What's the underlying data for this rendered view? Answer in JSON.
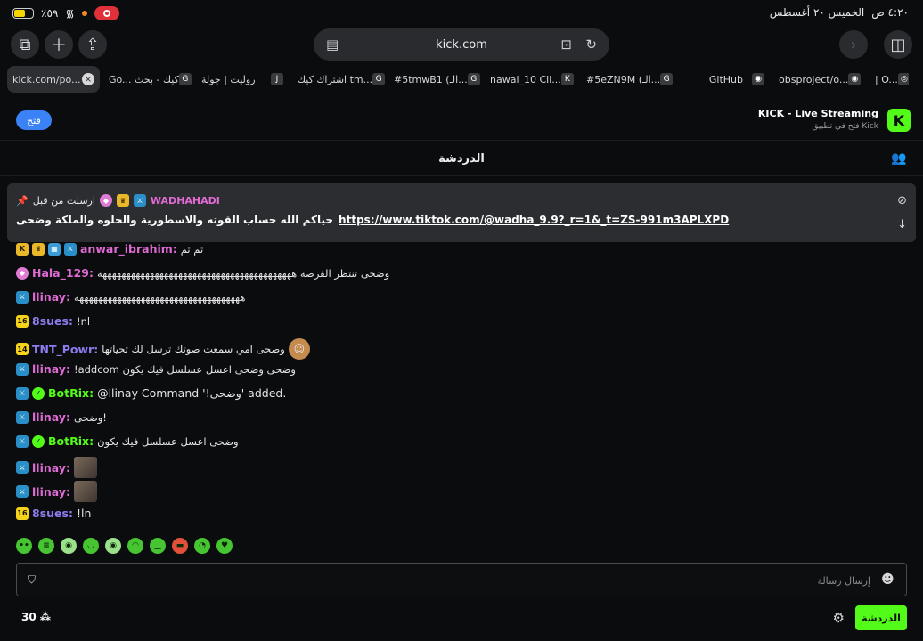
{
  "status_bar": {
    "battery": "٪٥٩",
    "time": "٤:٢٠ ص",
    "date": "الخميس ٢٠ أغسطس"
  },
  "browser": {
    "address": "kick.com",
    "tabs": [
      {
        "label": "kick.com/po...",
        "fav": "K",
        "active": true
      },
      {
        "label": "Go... كيك - بحث",
        "fav": "G"
      },
      {
        "label": "روليت | جولة",
        "fav": "J"
      },
      {
        "label": "اشتراك كيك tm...",
        "fav": "G"
      },
      {
        "label": "#5tmwB1 (الـ...",
        "fav": "G"
      },
      {
        "label": "nawal_10 Cli...",
        "fav": "K"
      },
      {
        "label": "#5eZN9M (الـ...",
        "fav": "G"
      },
      {
        "label": "GitHub",
        "fav": "◉"
      },
      {
        "label": "obsproject/o...",
        "fav": "◉"
      },
      {
        "label": "| O...",
        "fav": "◎"
      }
    ]
  },
  "banner": {
    "open_label": "فتح",
    "title": "KICK - Live Streaming",
    "subtitle": "فتح في تطبيق Kick",
    "logo": "K"
  },
  "chat": {
    "title": "الدردشة",
    "pinned": {
      "label": "ارسلت من قبل",
      "user": "WADHAHADI",
      "text_ar": "حياكم الله حساب القوته والاسطورية والحلوه والملكة وضحى",
      "link": "https://www.tiktok.com/@wadha_9.9?_r=1&_t=ZS-991m3APLXPD"
    },
    "messages": [
      {
        "user": "anwar_ibrahim:",
        "color": "#e06ad4",
        "text": "تم تم",
        "badges": [
          "b-vip",
          "b-vip",
          "b-og",
          "b-mod"
        ]
      },
      {
        "user": "Hala_129:",
        "color": "#e06ad4",
        "text": "وضحى تنتظر الفرصه هههههههههههههههههههههههههههههههههههههههههه",
        "badges": [
          "b-pink"
        ]
      },
      {
        "user": "llinay:",
        "color": "#e06ad4",
        "text": "هههههههههههههههههههههههههههههههههههه",
        "badges": [
          "b-mod"
        ]
      },
      {
        "user": "8sues:",
        "color": "#8d7cf0",
        "text": "!nl",
        "badges": [
          "b-sub"
        ]
      },
      {
        "user": "TNT_Powr:",
        "color": "#8d7cf0",
        "text": "وضحى امي سمعت صوتك ترسل لك تحياتها",
        "badges": [
          "b-sub"
        ]
      },
      {
        "user": "llinay:",
        "color": "#e06ad4",
        "text": "!addcom وضحى وضحى اعسل عسلسل فيك يكون",
        "badges": [
          "b-mod"
        ]
      },
      {
        "user": "BotRix:",
        "color": "#53fc18",
        "text": "@llinay Command '!وضحى' added.",
        "badges": [
          "b-mod",
          "b-ver"
        ]
      },
      {
        "user": "llinay:",
        "color": "#e06ad4",
        "text": "وضحى!",
        "badges": [
          "b-mod"
        ]
      },
      {
        "user": "BotRix:",
        "color": "#53fc18",
        "text": "وضحى اعسل عسلسل فيك يكون",
        "badges": [
          "b-mod",
          "b-ver"
        ]
      },
      {
        "user": "llinay:",
        "color": "#e06ad4",
        "text": "",
        "badges": [
          "b-mod"
        ]
      },
      {
        "user": "llinay:",
        "color": "#e06ad4",
        "text": "",
        "badges": [
          "b-mod"
        ]
      },
      {
        "user": "8sues:",
        "color": "#8d7cf0",
        "text": "!ln",
        "badges": [
          "b-sub"
        ]
      }
    ],
    "input_placeholder": "إرسال رسالة",
    "viewers": "30",
    "send_label": "الدردشة"
  }
}
